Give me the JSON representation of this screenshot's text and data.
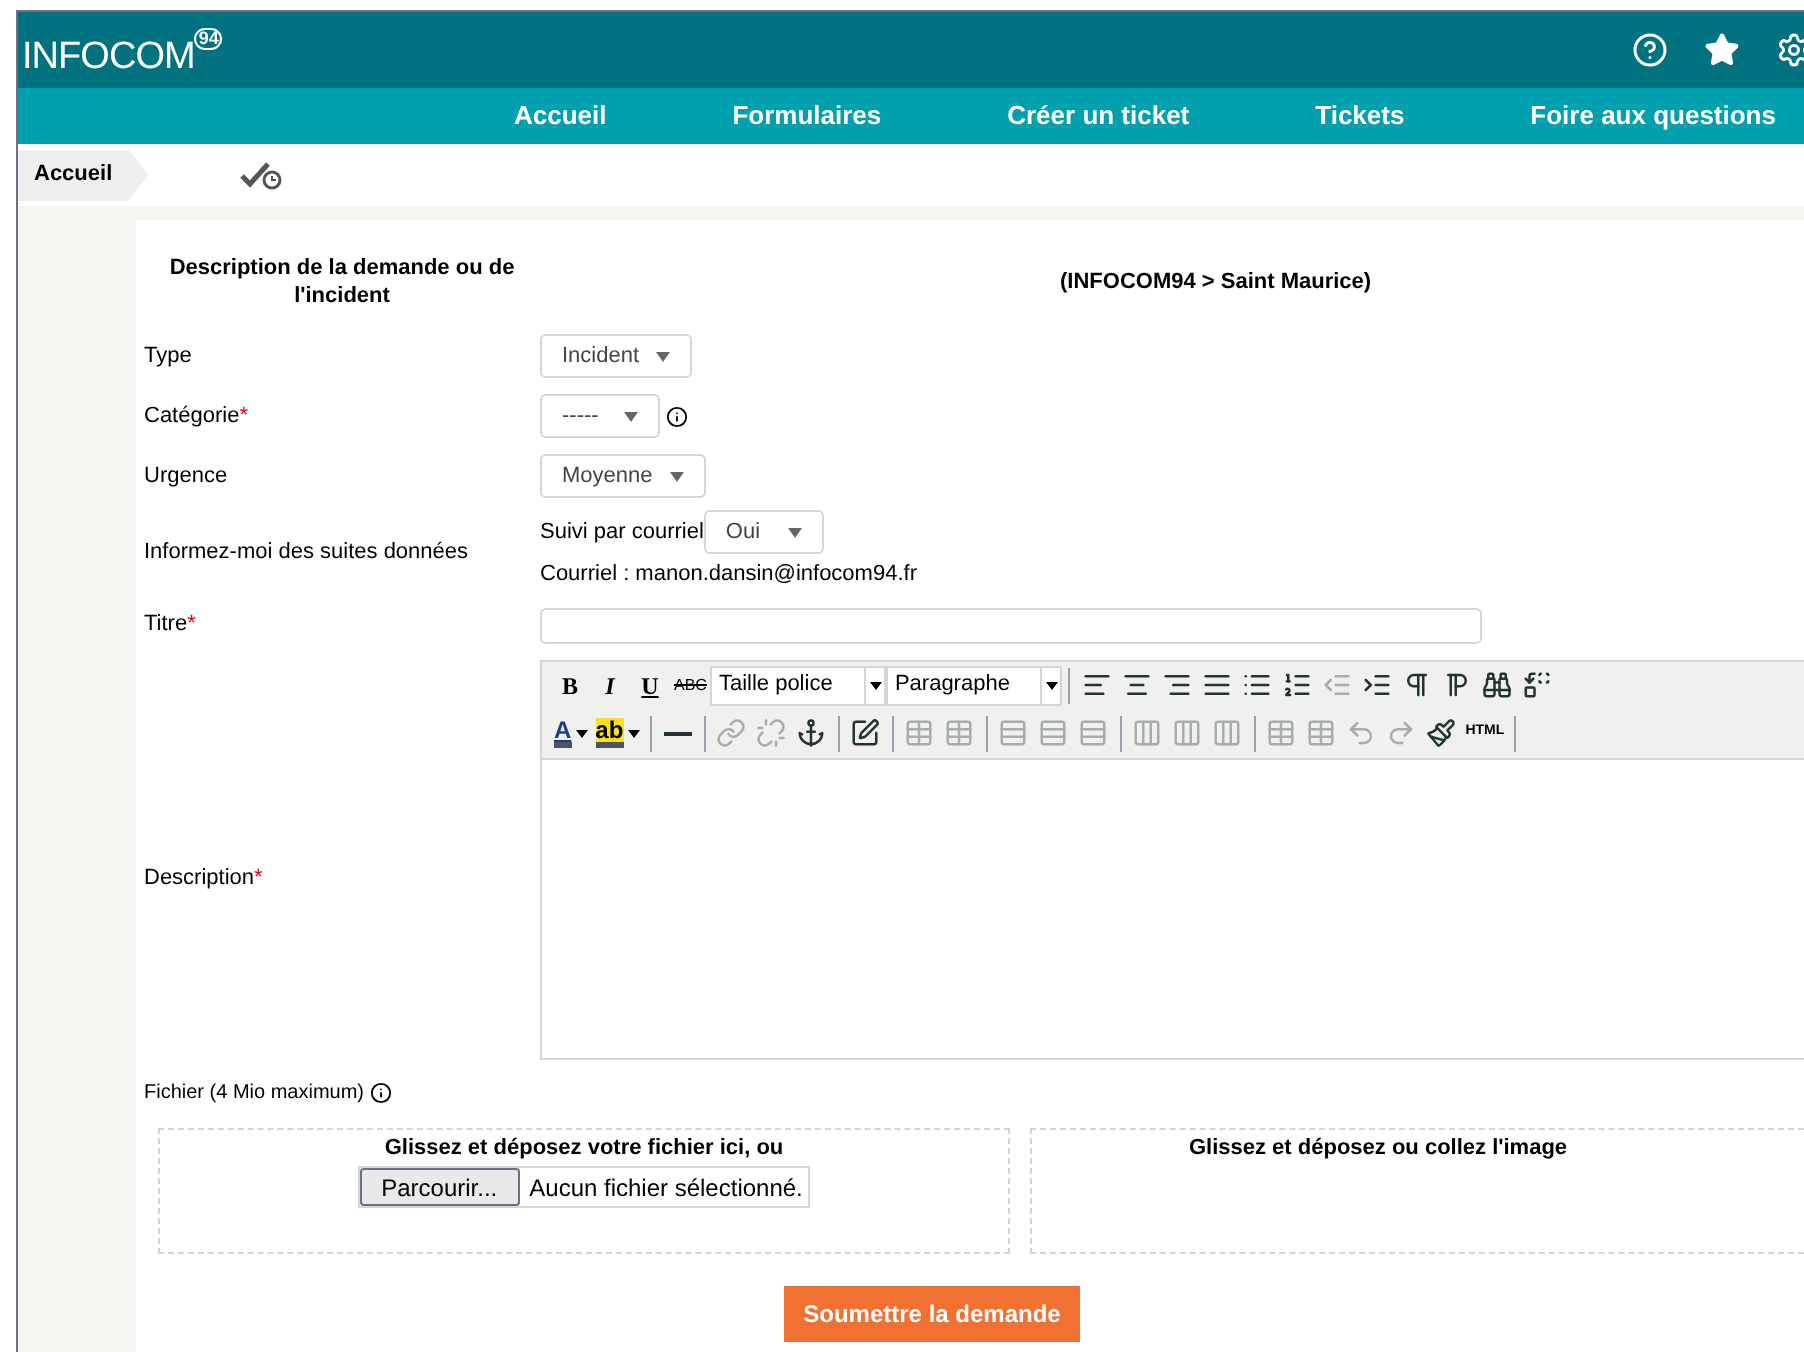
{
  "header": {
    "logo": "INFOCOM",
    "logo_sup": "94"
  },
  "nav": [
    {
      "label": "Accueil",
      "selected": false
    },
    {
      "label": "Formulaires",
      "selected": false
    },
    {
      "label": "Créer un ticket",
      "selected": false
    },
    {
      "label": "Tickets",
      "selected": false
    },
    {
      "label": "Foire aux questions",
      "selected": false
    }
  ],
  "breadcrumb": {
    "label": "Accueil"
  },
  "form": {
    "required_mark": "*",
    "title": "Description de la demande ou de l'incident",
    "entity": "(INFOCOM94 >  Saint Maurice)",
    "type": {
      "label": "Type",
      "required": false,
      "value": "Incident"
    },
    "category": {
      "label": "Catégorie",
      "required": true,
      "value": "-----"
    },
    "urgency": {
      "label": "Urgence",
      "required": false,
      "value": "Moyenne"
    },
    "notify": {
      "label": "Informez-moi des suites données",
      "follow_label": "Suivi par courriel",
      "follow_value": "Oui",
      "email": "Courriel : manon.dansin@infocom94.fr"
    },
    "title_field": {
      "label": "Titre",
      "required": true
    },
    "description": {
      "label": "Description",
      "required": true,
      "toolbar_rows": [
        [
          {
            "kind": "bold",
            "label": "B",
            "disabled": false
          },
          {
            "kind": "italic",
            "label": "I",
            "disabled": false
          },
          {
            "kind": "underline",
            "label": "U",
            "disabled": false
          },
          {
            "kind": "strike",
            "label": "ABC",
            "disabled": false
          },
          {
            "kind": "select",
            "label": "Taille police",
            "disabled": false
          },
          {
            "kind": "select",
            "label": "Paragraphe",
            "disabled": false
          },
          {
            "kind": "sep"
          },
          {
            "kind": "align-left",
            "disabled": false
          },
          {
            "kind": "align-center",
            "disabled": false
          },
          {
            "kind": "align-right",
            "disabled": false
          },
          {
            "kind": "justify",
            "disabled": false
          },
          {
            "kind": "bullets",
            "disabled": false
          },
          {
            "kind": "numbers",
            "disabled": false
          },
          {
            "kind": "outdent",
            "disabled": true
          },
          {
            "kind": "indent",
            "disabled": false
          },
          {
            "kind": "ltr",
            "disabled": false
          },
          {
            "kind": "rtl",
            "disabled": false
          },
          {
            "kind": "find",
            "disabled": false
          },
          {
            "kind": "replace",
            "disabled": false
          }
        ],
        [
          {
            "kind": "color",
            "label": "A",
            "disabled": false
          },
          {
            "kind": "highlight",
            "label": "ab",
            "disabled": false
          },
          {
            "kind": "sep"
          },
          {
            "kind": "rule",
            "disabled": false
          },
          {
            "kind": "sep"
          },
          {
            "kind": "link",
            "disabled": true
          },
          {
            "kind": "unlink",
            "disabled": true
          },
          {
            "kind": "anchor",
            "disabled": false
          },
          {
            "kind": "sep"
          },
          {
            "kind": "image",
            "disabled": false
          },
          {
            "kind": "sep"
          },
          {
            "kind": "table",
            "disabled": true
          },
          {
            "kind": "table",
            "disabled": true
          },
          {
            "kind": "sep"
          },
          {
            "kind": "row-before",
            "disabled": true
          },
          {
            "kind": "row-after",
            "disabled": true
          },
          {
            "kind": "row-delete",
            "disabled": true
          },
          {
            "kind": "sep"
          },
          {
            "kind": "col-before",
            "disabled": true
          },
          {
            "kind": "col-after",
            "disabled": true
          },
          {
            "kind": "col-delete",
            "disabled": true
          },
          {
            "kind": "sep"
          },
          {
            "kind": "table",
            "disabled": true
          },
          {
            "kind": "table",
            "disabled": true
          },
          {
            "kind": "undo",
            "disabled": true
          },
          {
            "kind": "redo",
            "disabled": true
          },
          {
            "kind": "cleanup",
            "disabled": false
          },
          {
            "kind": "html",
            "label": "HTML",
            "disabled": false
          },
          {
            "kind": "sep"
          }
        ]
      ]
    },
    "file": {
      "label": "Fichier (4 Mio maximum)",
      "drop_text": "Glissez et déposez votre fichier ici, ou",
      "browse": "Parcourir...",
      "no_file": "Aucun fichier sélectionné.",
      "image_drop": "Glissez et déposez ou collez l'image"
    },
    "submit": "Soumettre la demande"
  }
}
